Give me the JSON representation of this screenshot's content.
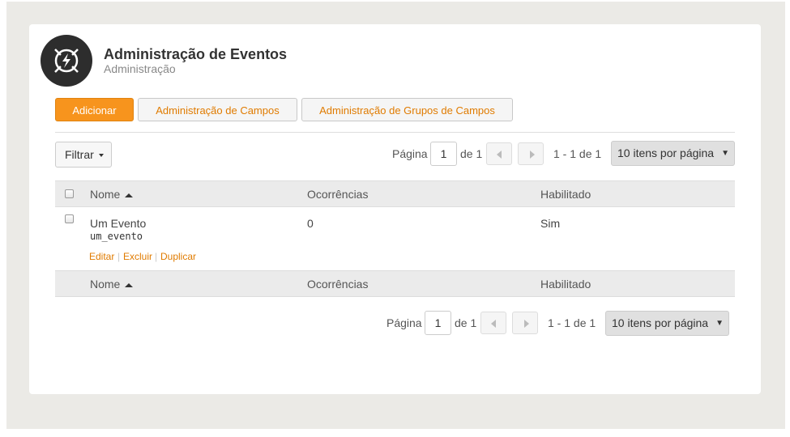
{
  "header": {
    "title": "Administração de Eventos",
    "subtitle": "Administração"
  },
  "toolbar": {
    "add_label": "Adicionar",
    "fields_label": "Administração de Campos",
    "field_groups_label": "Administração de Grupos de Campos"
  },
  "filter": {
    "label": "Filtrar"
  },
  "pagination": {
    "page_label": "Página",
    "page_value": "1",
    "of_label": "de 1",
    "range": "1 - 1 de 1",
    "per_page": "10 itens por página"
  },
  "table": {
    "columns": [
      "Nome",
      "Ocorrências",
      "Habilitado"
    ],
    "rows": [
      {
        "name": "Um Evento",
        "key": "um_evento",
        "occurrences": "0",
        "enabled": "Sim",
        "actions": [
          "Editar",
          "Excluir",
          "Duplicar"
        ]
      }
    ]
  },
  "colors": {
    "accent": "#f7941d",
    "link": "#e07b00",
    "header_bg": "#ebebeb",
    "frame_bg": "#ebeae6"
  },
  "icons": {
    "logo": "event-bolt-icon",
    "prev": "chevron-left-icon",
    "next": "chevron-right-icon"
  }
}
